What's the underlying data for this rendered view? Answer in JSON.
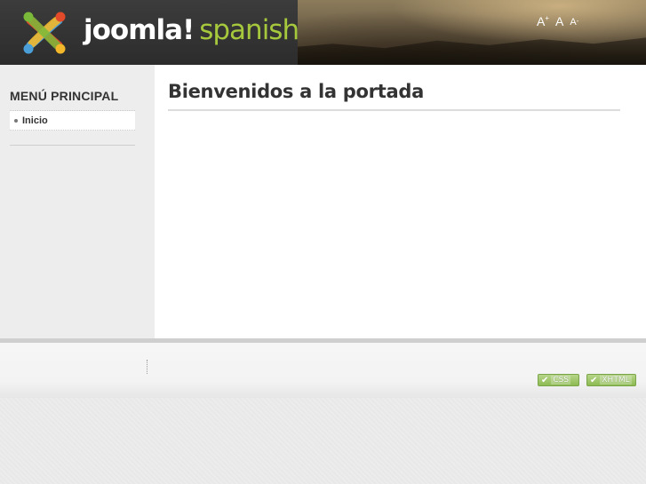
{
  "header": {
    "logo_word": "joomla!",
    "logo_suffix": "spanish",
    "font_size": {
      "increase": "A",
      "increase_mark": "+",
      "reset": "A",
      "decrease": "A",
      "decrease_mark": "-"
    }
  },
  "sidebar": {
    "title": "MENÚ PRINCIPAL",
    "items": [
      {
        "label": "Inicio"
      }
    ]
  },
  "main": {
    "title": "Bienvenidos a la portada"
  },
  "footer": {
    "badges": [
      {
        "label": "CSS",
        "icon": "check-icon"
      },
      {
        "label": "XHTML",
        "icon": "check-icon"
      }
    ]
  },
  "colors": {
    "logo_accent": "#a6c83c",
    "badge_green": "#8dbb52"
  }
}
